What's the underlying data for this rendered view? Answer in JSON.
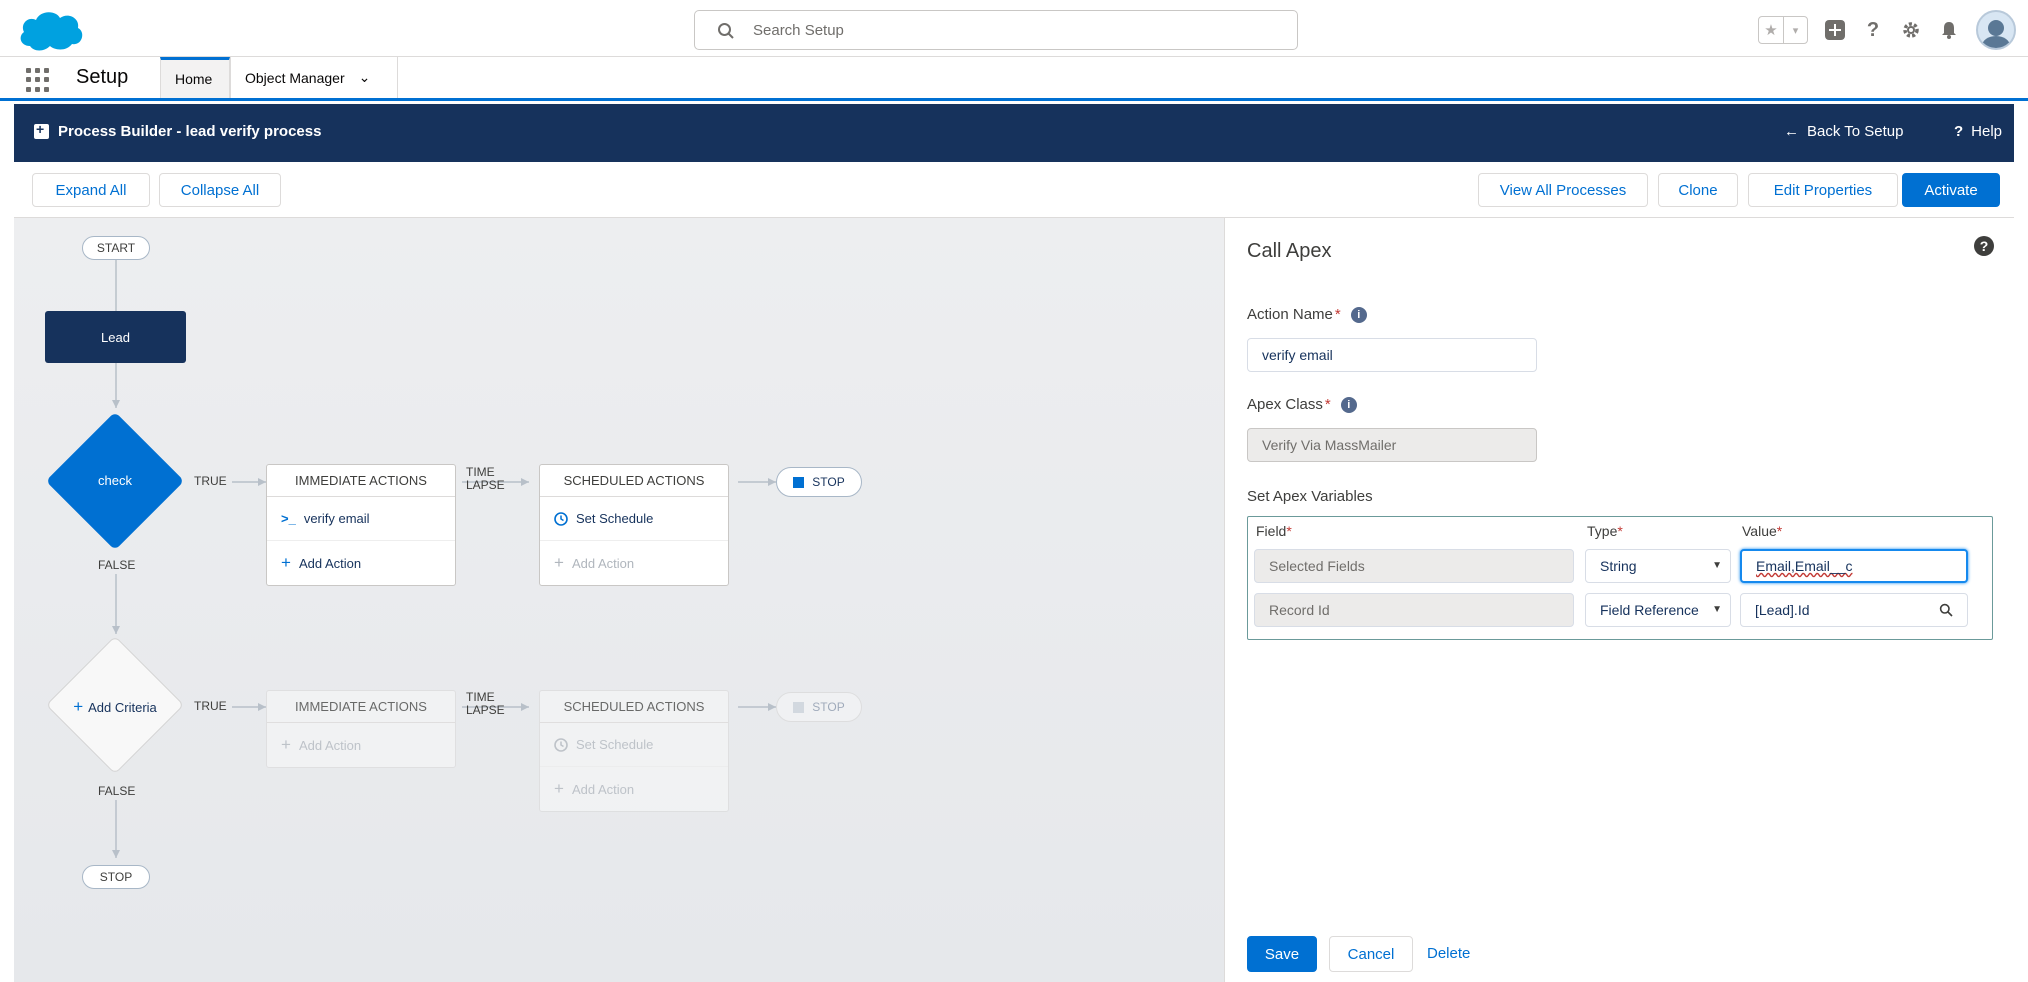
{
  "global_header": {
    "search_placeholder": "Search Setup",
    "icons": [
      "favorites-star-icon",
      "favorites-list-icon",
      "global-actions-add-icon",
      "help-icon",
      "setup-gear-icon",
      "notifications-bell-icon",
      "user-avatar"
    ]
  },
  "app_nav": {
    "app_name": "Setup",
    "tabs": [
      {
        "label": "Home",
        "active": true
      },
      {
        "label": "Object Manager",
        "active": false,
        "has_dropdown": true
      }
    ]
  },
  "process_header": {
    "title": "Process Builder - lead verify process",
    "back_label": "Back To Setup",
    "help_label": "Help"
  },
  "toolbar": {
    "expand_all": "Expand All",
    "collapse_all": "Collapse All",
    "view_all_processes": "View All Processes",
    "clone": "Clone",
    "edit_properties": "Edit Properties",
    "activate": "Activate"
  },
  "canvas": {
    "start_label": "START",
    "object_node": "Lead",
    "criteria": [
      {
        "name": "check",
        "true_label": "TRUE",
        "false_label": "FALSE",
        "time_lapse": "TIME LAPSE",
        "immediate_header": "IMMEDIATE ACTIONS",
        "immediate_items": [
          "verify email",
          "Add Action"
        ],
        "scheduled_header": "SCHEDULED ACTIONS",
        "scheduled_items": [
          "Set Schedule",
          "Add Action"
        ],
        "stop_label": "STOP"
      },
      {
        "name": "Add Criteria",
        "true_label": "TRUE",
        "false_label": "FALSE",
        "time_lapse": "TIME LAPSE",
        "immediate_header": "IMMEDIATE ACTIONS",
        "immediate_items": [
          "Add Action"
        ],
        "scheduled_header": "SCHEDULED ACTIONS",
        "scheduled_items": [
          "Set Schedule",
          "Add Action"
        ],
        "stop_label": "STOP"
      }
    ],
    "end_label": "STOP"
  },
  "panel": {
    "title": "Call Apex",
    "action_name_label": "Action Name",
    "action_name_value": "verify email",
    "apex_class_label": "Apex Class",
    "apex_class_value": "Verify Via MassMailer",
    "vars_label": "Set Apex Variables",
    "columns": {
      "field": "Field",
      "type": "Type",
      "value": "Value"
    },
    "rows": [
      {
        "field": "Selected Fields",
        "type": "String",
        "value": "Email,Email__c"
      },
      {
        "field": "Record Id",
        "type": "Field Reference",
        "value": "[Lead].Id"
      }
    ],
    "save": "Save",
    "cancel": "Cancel",
    "delete": "Delete"
  },
  "colors": {
    "brand": "#0070d2",
    "header_navy": "#16325c",
    "panel_border_teal": "#6b9a9a"
  }
}
